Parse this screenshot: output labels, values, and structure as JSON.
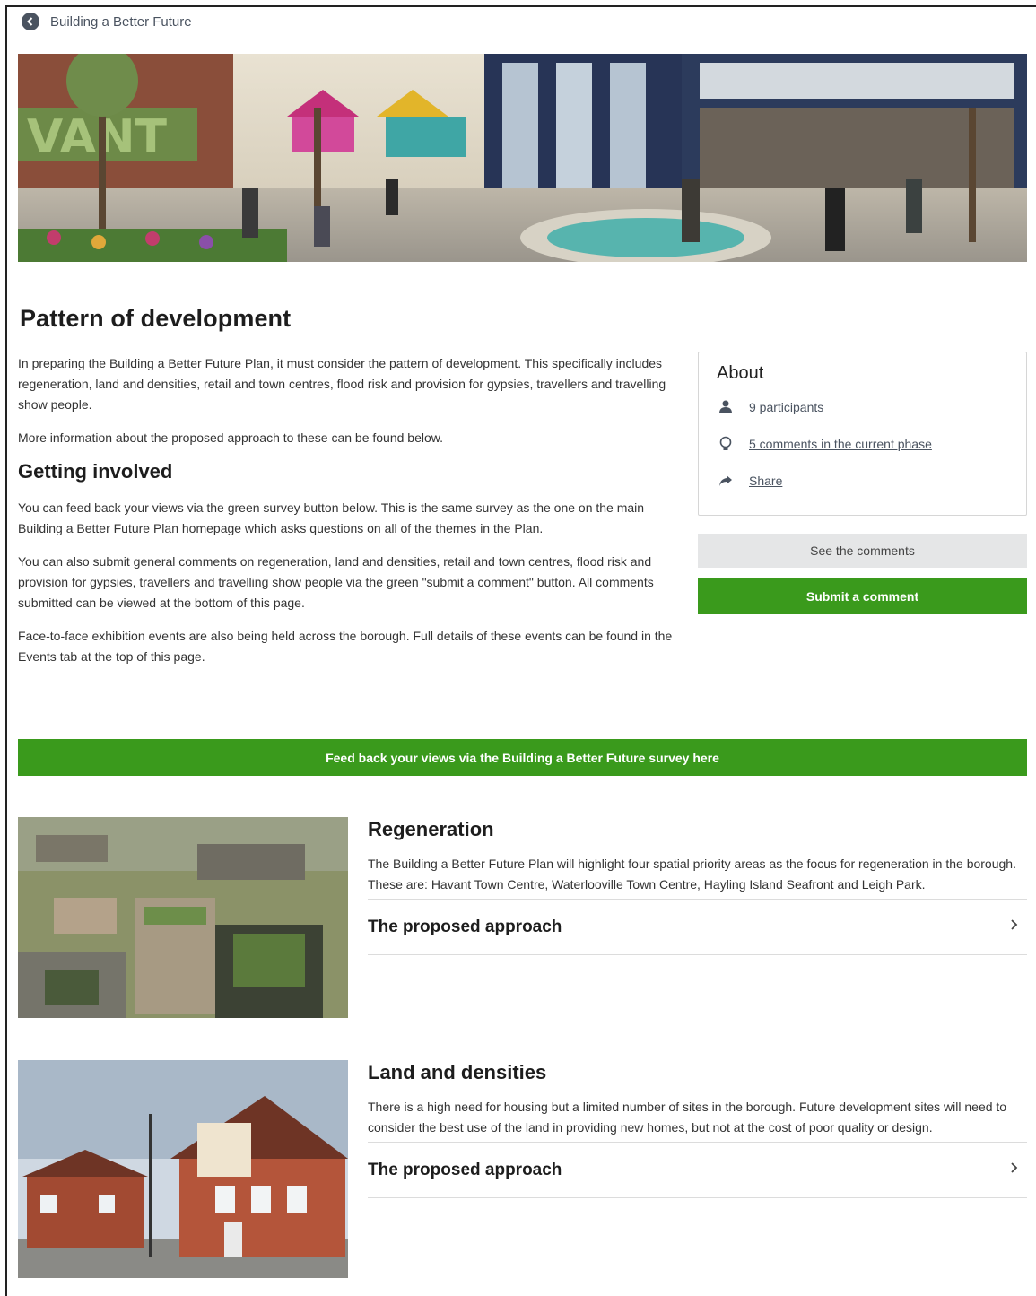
{
  "nav": {
    "back_label": "Building a Better Future"
  },
  "page": {
    "title": "Pattern of development"
  },
  "intro": {
    "paragraphs": [
      "In preparing the Building a Better Future Plan, it must consider the pattern of development. This specifically includes regeneration, land and densities, retail and town centres, flood risk and provision for gypsies, travellers and travelling show people.",
      "More information about the proposed approach to these can be found below."
    ],
    "getting_involved_heading": "Getting involved",
    "involved_paragraphs": [
      "You can feed back your views via the green survey button below. This is the same survey as the one on the main Building a Better Future Plan homepage which asks questions on all of the themes in the Plan.",
      "You can also submit general comments on regeneration, land and densities, retail and town centres, flood risk and provision for gypsies, travellers and travelling show people via the green \"submit a comment\" button. All comments submitted can be viewed at the bottom of this page.",
      "Face-to-face exhibition events are also being held across the borough. Full details of these events can be found in the Events tab at the top of this page."
    ]
  },
  "about": {
    "title": "About",
    "participants": "9 participants",
    "comments": "5 comments in the current phase",
    "share": "Share"
  },
  "buttons": {
    "see_comments": "See the comments",
    "submit_comment": "Submit a comment",
    "survey": "Feed back your views via the Building a Better Future survey here"
  },
  "sections": [
    {
      "title": "Regeneration",
      "text": "The Building a Better Future Plan will highlight four spatial priority areas as the focus for regeneration in the borough. These are: Havant Town Centre, Waterlooville Town Centre, Hayling Island Seafront and Leigh Park.",
      "link": "The proposed approach"
    },
    {
      "title": "Land and densities",
      "text": "There is a high need for housing but a limited number of sites in the borough. Future development sites will need to consider the best use of the land in providing new homes, but not at the cost of poor quality or design.",
      "link": "The proposed approach"
    }
  ],
  "colors": {
    "accent_green": "#3a9a1c",
    "muted_grey": "#e5e6e7",
    "link_grey": "#4a5360"
  },
  "icons": [
    "back-arrow-icon",
    "person-icon",
    "lightbulb-icon",
    "share-arrow-icon",
    "chevron-right-icon"
  ]
}
